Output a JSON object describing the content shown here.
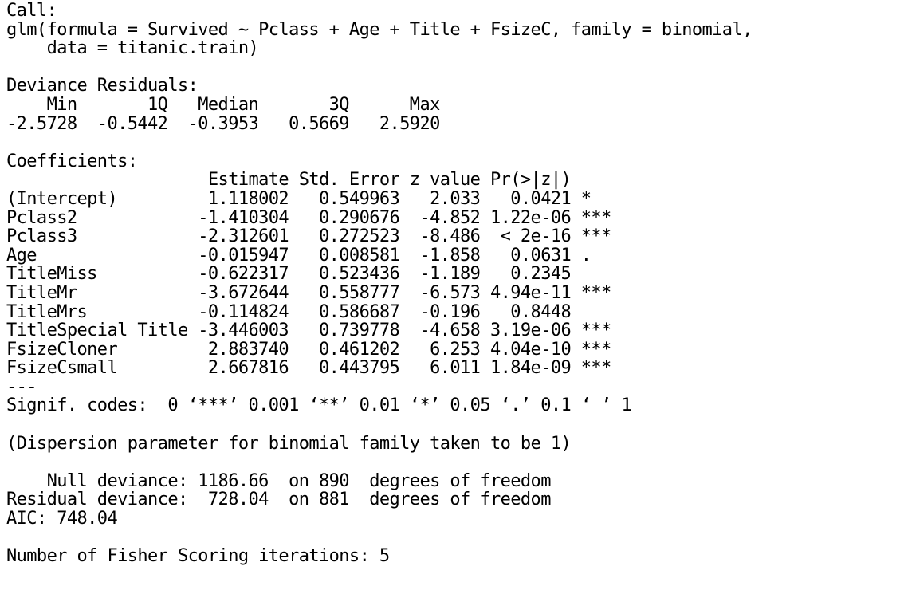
{
  "console": {
    "lines": [
      "Call:",
      "glm(formula = Survived ~ Pclass + Age + Title + FsizeC, family = binomial,",
      "    data = titanic.train)",
      "",
      "Deviance Residuals:",
      "    Min       1Q   Median       3Q      Max",
      "-2.5728  -0.5442  -0.3953   0.5669   2.5920",
      "",
      "Coefficients:",
      "                    Estimate Std. Error z value Pr(>|z|)",
      "(Intercept)         1.118002   0.549963   2.033   0.0421 *",
      "Pclass2            -1.410304   0.290676  -4.852 1.22e-06 ***",
      "Pclass3            -2.312601   0.272523  -8.486  < 2e-16 ***",
      "Age                -0.015947   0.008581  -1.858   0.0631 .",
      "TitleMiss          -0.622317   0.523436  -1.189   0.2345",
      "TitleMr            -3.672644   0.558777  -6.573 4.94e-11 ***",
      "TitleMrs           -0.114824   0.586687  -0.196   0.8448",
      "TitleSpecial Title -3.446003   0.739778  -4.658 3.19e-06 ***",
      "FsizeCloner         2.883740   0.461202   6.253 4.04e-10 ***",
      "FsizeCsmall         2.667816   0.443795   6.011 1.84e-09 ***",
      "---",
      "Signif. codes:  0 ‘***’ 0.001 ‘**’ 0.01 ‘*’ 0.05 ‘.’ 0.1 ‘ ’ 1",
      "",
      "(Dispersion parameter for binomial family taken to be 1)",
      "",
      "    Null deviance: 1186.66  on 890  degrees of freedom",
      "Residual deviance:  728.04  on 881  degrees of freedom",
      "AIC: 748.04",
      "",
      "Number of Fisher Scoring iterations: 5"
    ]
  }
}
